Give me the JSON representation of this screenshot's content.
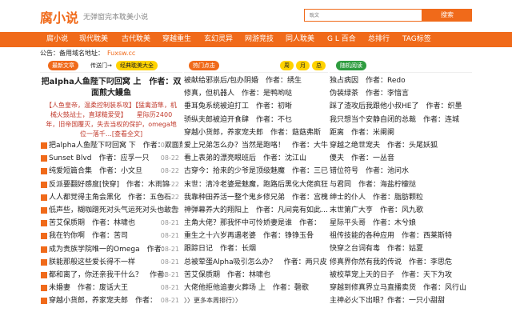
{
  "header": {
    "logo": "腐小说",
    "slogan": "无弹窗完本耽美小说",
    "search_placeholder": "耽文",
    "search_button": "搜索"
  },
  "nav": [
    "腐小说",
    "现代耽美",
    "古代耽美",
    "穿越重生",
    "玄幻灵异",
    "网游竞技",
    "同人耽美",
    "G L 百合",
    "总排行",
    "TAG标签"
  ],
  "notice": {
    "label": "公告：备用域名地址：",
    "url": "Fuxsw.cc"
  },
  "col1": {
    "badge_new": "最新文章",
    "badge_portal": "传送门→",
    "badge_finished": "经典耽美大全",
    "feature_title": "把alpha人鱼陛下叼回窝 上　作者：双面煎大鳗鱼",
    "feature_desc": "【人鱼皇帝，温柔控制装系攻】【猛禽游隼，机械火鼓战士，直球糙爱受】　　星际历2400年，旧帝国覆灭，失去当权的保护，omega地位一落千…[查看全文]",
    "items": [
      {
        "title": "把alpha人鱼陛下叼回窝 下　作者：双面煎大鳗鱼",
        "date": "08-22"
      },
      {
        "title": "Sunset Blvd　作者：应孚一只",
        "date": "08-22"
      },
      {
        "title": "纯爱短篇合集　作者：小文旦",
        "date": "08-22"
      },
      {
        "title": "反派要翻好感度[快穿]　作者：木雨锦",
        "date": "08-22"
      },
      {
        "title": "人人都觉得主角会黑化　作者：五色石",
        "date": "08-22"
      },
      {
        "title": "低声些，糊咖蹭死对头气运死对头也敢告",
        "date": "08-22"
      },
      {
        "title": "苦艾保质期　作者：林啸也",
        "date": "08-21"
      },
      {
        "title": "我在钓你啊　作者：苦司",
        "date": "08-21"
      },
      {
        "title": "成为贵族学院唯一的Omega　作者：",
        "date": "08-21"
      },
      {
        "title": "朕能那般这些爱长得不一样",
        "date": "08-21"
      },
      {
        "title": "都和离了，你还亲我干什么？　作者：",
        "date": "08-21"
      },
      {
        "title": "未婚妻　作者：废话大王",
        "date": "08-21"
      },
      {
        "title": "穿越小货郎，养家宠夫郎　作者：",
        "date": "08-21"
      }
    ]
  },
  "col2": {
    "badge_hot": "热门点击",
    "badge_week": "周",
    "badge_month": "月",
    "badge_total": "总",
    "items": [
      "被献给邪祟后/包办阴婚　作者：绣生",
      "修真，但机器人　作者：是鸭哟哒",
      "垂耳兔系统被迫打工　作者：初晰",
      "骄纵夫郎被迫开食肆　作者：不乜",
      "穿越小货郎，养家宠夫郎　作者：菇菇弗斯",
      "爱上兄弟怎么办？当然是跑咯！　作者：大牛宝",
      "看上表弟的漂亮眼班后　作者：沈江山",
      "古穿今：拾来的少爷是顶级魅魔　作者：三已心",
      "末世：清冷老婆是魅魔，跑路后黑化大佬疯狂",
      "我靠种田养活一整个鬼乡修兄弟　作者：宫槐知玉",
      "神弹幕养大的翔阳上　作者：凡间竟有如此…",
      "主角大佬？那我怀中可怜娇妻是谁　作者：",
      "重生之十六岁再遇老婆　作者：铮铮玉骨",
      "跟踪日记　作者：长烟",
      "总被荤蛋Alpha吸引怎么办？　作者：两只皮",
      "苦艾保质期　作者：林啸也",
      "大佬他拒他追妻火葬场 上　作者：磬歌"
    ],
    "more": "〉〉更多本周排行〉〉"
  },
  "col3": {
    "badge_random": "随机阅读",
    "items": [
      "独占病因　作者：Redo",
      "伪装绿茶　作者：李愔言",
      "踩了渣攻后我跟他小叔HE了　作者：织墨",
      "我只想当个安静自闭的总裁　作者：连城",
      "距离　作者：米阑阑",
      "穿越之绝世宠夫　作者：头尾妖狐",
      "傻夫　作者：一丛音",
      "错位符号　作者：池问水",
      "与君同　作者：海盐柠檬挞",
      "绅士的仆人　作者：脂肪颗粒",
      "末世第广大亨　作者：风九歌",
      "星际平头哥　作者：木兮娘",
      "祖传技能的各种应用　作者：西莱斯特",
      "快穿之台词有毒　作者：姑夏",
      "修真界你然有我的传说　作者：李思危",
      "被校草宠上天的日子　作者：天下为攻",
      "穿越到修真界立马直播卖货　作者：风行山",
      "主神必火下出眼？作者：一只小甜甜"
    ]
  }
}
